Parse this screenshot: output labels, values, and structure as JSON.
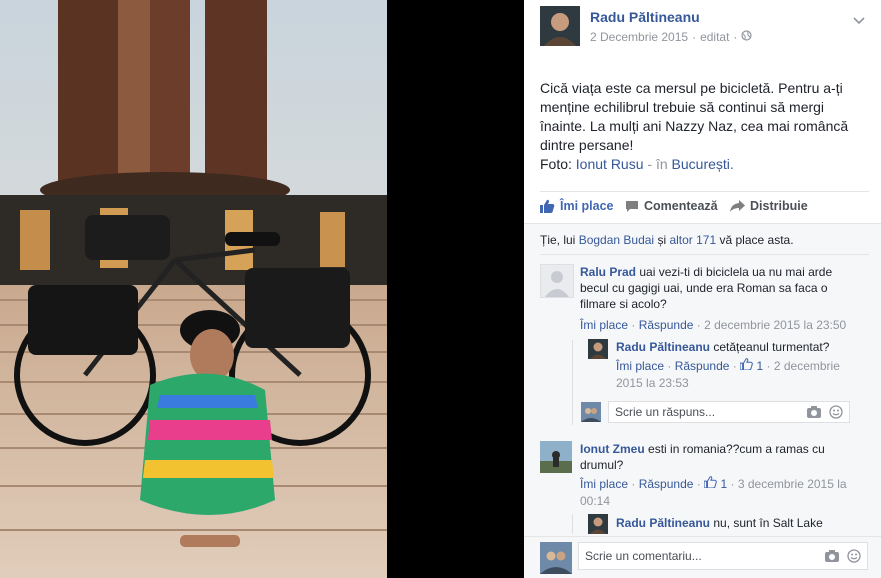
{
  "post": {
    "author": "Radu Păltineanu",
    "date": "2 Decembrie 2015",
    "edited": "editat",
    "dot": "·",
    "text": "Cică viața este ca mersul pe bicicletă. Pentru a-ți menține echilibrul trebuie să continui să mergi înainte. La mulți ani Nazzy Naz, cea mai româncă dintre persane!",
    "photo_label": "Foto:",
    "photo_by": "Ionut Rusu",
    "in_label": "- în",
    "location": "București."
  },
  "actions": {
    "like": "Îmi place",
    "comment": "Comentează",
    "share": "Distribuie"
  },
  "likes": {
    "prefix": "Ție, lui",
    "person": "Bogdan Budai",
    "and": "și",
    "others": "altor 171",
    "suffix": "vă place asta."
  },
  "comments": [
    {
      "author": "Ralu Prad",
      "text": "uai vezi-ti di biciclela ua nu mai arde becul cu gagigi uai, unde era Roman sa faca o filmare si acolo?",
      "like": "Îmi place",
      "reply": "Răspunde",
      "time": "2 decembrie 2015 la 23:50"
    },
    {
      "author": "Radu Păltineanu",
      "text": "cetățeanul turmentat?",
      "like": "Îmi place",
      "reply": "Răspunde",
      "reactions": "1",
      "time": "2 decembrie 2015 la 23:53"
    },
    {
      "author": "Ionut Zmeu",
      "text": "esti in romania??cum a ramas cu drumul?",
      "like": "Îmi place",
      "reply": "Răspunde",
      "reactions": "1",
      "time": "3 decembrie 2015 la 00:14"
    },
    {
      "author": "Radu Păltineanu",
      "text": "nu, sunt în Salt Lake"
    }
  ],
  "reply_input": {
    "placeholder": "Scrie un răspuns..."
  },
  "comment_input": {
    "placeholder": "Scrie un comentariu..."
  },
  "colors": {
    "link": "#365899",
    "text": "#1d2129",
    "meta": "#90949c",
    "like_active": "#4267b2"
  }
}
